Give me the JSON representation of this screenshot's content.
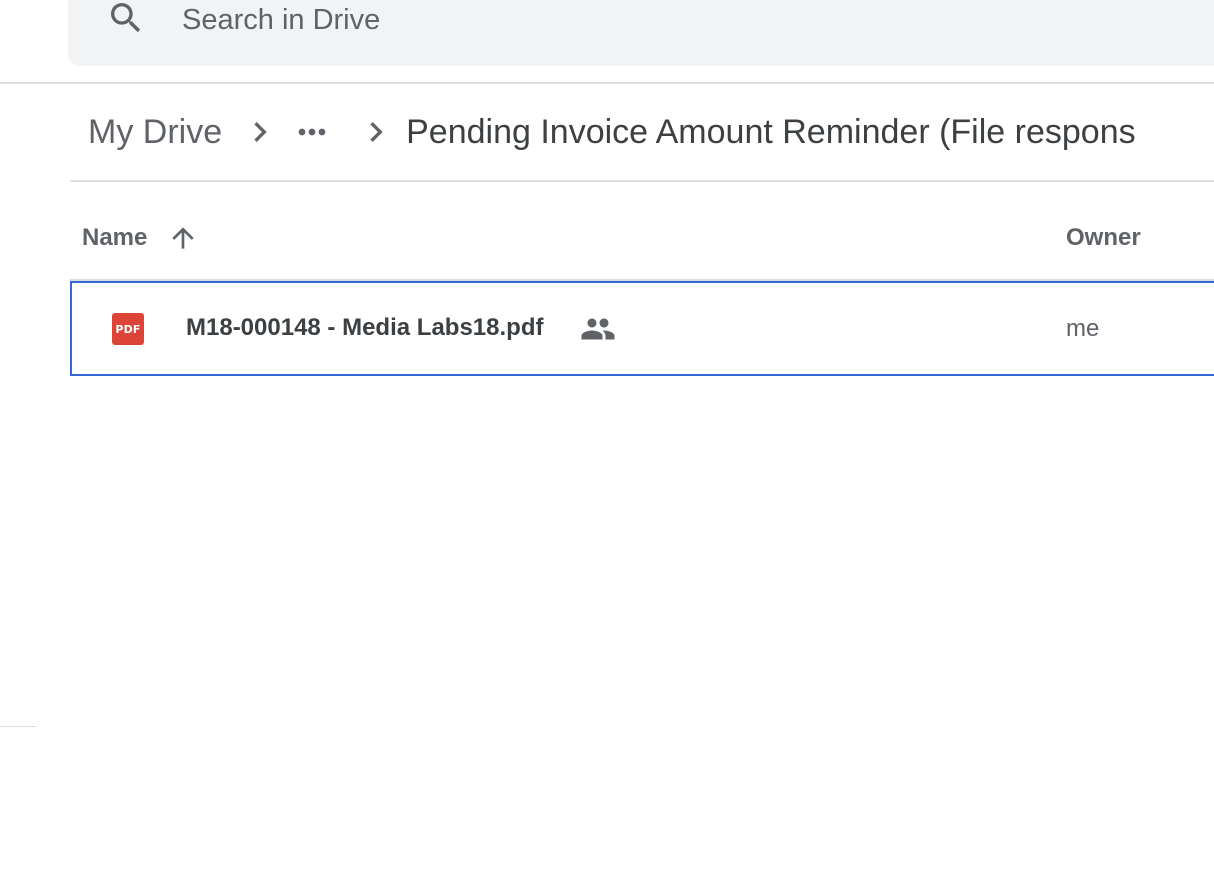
{
  "search": {
    "placeholder": "Search in Drive",
    "value": "",
    "icon": "search-icon"
  },
  "breadcrumb": {
    "root": "My Drive",
    "more": "more-horiz-icon",
    "current": "Pending Invoice Amount Reminder (File respons"
  },
  "columns": {
    "name": "Name",
    "owner": "Owner",
    "sort": "arrow-upward-icon"
  },
  "files": [
    {
      "name": "M18-000148 - Media Labs18.pdf",
      "type_icon": "pdf-icon",
      "type_label": "PDF",
      "shared": true,
      "owner": "me"
    }
  ],
  "colors": {
    "selection_border": "#3367d6",
    "pdf_red": "#db4437",
    "search_bg": "#f1f3f4",
    "divider": "#dadce0"
  }
}
